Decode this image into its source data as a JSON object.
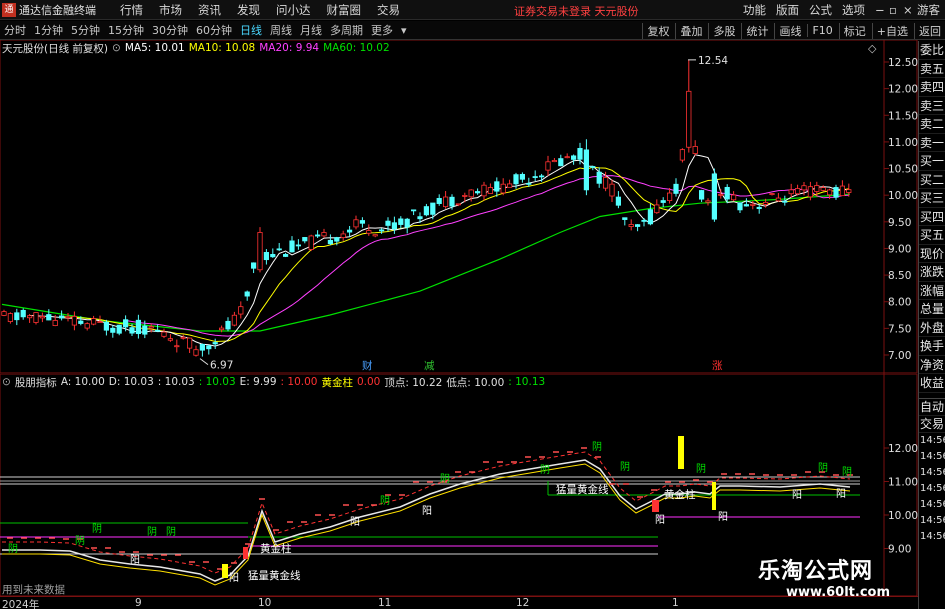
{
  "app": {
    "name": "通达信金融终端",
    "logo_text": "通"
  },
  "menu": [
    "行情",
    "市场",
    "资讯",
    "发现",
    "问小达",
    "财富圈",
    "交易"
  ],
  "notice": "证券交易未登录  天元股份",
  "right_menu": [
    "功能",
    "版面",
    "公式",
    "选项"
  ],
  "guest": "游客",
  "periods": [
    {
      "label": "分时"
    },
    {
      "label": "1分钟"
    },
    {
      "label": "5分钟"
    },
    {
      "label": "15分钟"
    },
    {
      "label": "30分钟"
    },
    {
      "label": "60分钟"
    },
    {
      "label": "日线",
      "active": true
    },
    {
      "label": "周线"
    },
    {
      "label": "月线"
    },
    {
      "label": "多周期"
    },
    {
      "label": "更多"
    }
  ],
  "toolbar_right": [
    "复权",
    "叠加",
    "多股",
    "统计",
    "画线",
    "F10",
    "标记",
    "+自选",
    "返回"
  ],
  "main_legend": {
    "stock": "天元股份(日线 前复权)",
    "ma5": "MA5: 10.01",
    "ma10": "MA10: 10.08",
    "ma20": "MA20: 9.94",
    "ma60": "MA60: 10.02"
  },
  "sub_legend": {
    "name": "股朋指标",
    "a": "A: 10.00",
    "d": "D: 10.03",
    "c": ": 10.03",
    "c2": ": 10.03",
    "e": "E: 9.99",
    "e2": ": 10.00",
    "gold_label": "黄金柱",
    "gold_val": "0.00",
    "top": "顶点: 10.22",
    "bottom": "低点: 10.00",
    "last": ": 10.13"
  },
  "price_axis": [
    "12.50",
    "12.00",
    "11.50",
    "11.00",
    "10.50",
    "10.00",
    "9.50",
    "9.00",
    "8.50",
    "8.00",
    "7.50",
    "7.00"
  ],
  "sub_axis": [
    "12.00",
    "11.00",
    "10.00",
    "9.00"
  ],
  "high_label": "12.54",
  "low_label": "6.97",
  "event_marks": [
    {
      "text": "财",
      "color": "#4aa0ff"
    },
    {
      "text": "减",
      "color": "#30c030"
    },
    {
      "text": "涨",
      "color": "#ff3030"
    }
  ],
  "sub_annotations": {
    "yin": "阴",
    "yang": "阳",
    "gold_line": "猛量黄金线",
    "gold_bar": "黄金柱"
  },
  "right_panel_top": [
    "委比",
    "卖五",
    "卖四",
    "卖三",
    "卖二",
    "卖一",
    "买一",
    "买二",
    "买三",
    "买四",
    "买五",
    "现价",
    "涨跌",
    "涨幅",
    "总量",
    "外盘",
    "换手",
    "净资",
    "收益"
  ],
  "right_panel_bottom": [
    "自动",
    "交易"
  ],
  "time_labels": [
    "14:56",
    "14:56",
    "14:56",
    "14:56",
    "14:56",
    "14:56",
    "14:56"
  ],
  "x_labels": [
    "2024年",
    "9",
    "10",
    "11",
    "12",
    "1"
  ],
  "no_data_text": "用到未来数据",
  "watermark": {
    "title": "乐淘公式网",
    "url": "www.60lt.com"
  },
  "colors": {
    "up": "#ff3232",
    "down": "#54ffff",
    "ma5": "#ffffff",
    "ma10": "#ffff00",
    "ma20": "#ff40ff",
    "ma60": "#00e000",
    "gold": "#ffff00",
    "axis": "#7a1010"
  }
}
